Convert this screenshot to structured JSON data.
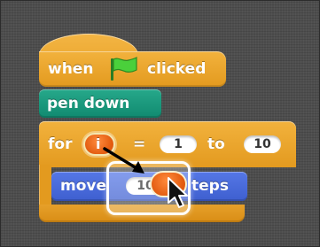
{
  "script": {
    "hat": {
      "when_label": "when",
      "clicked_label": "clicked",
      "flag_icon": "green-flag-icon"
    },
    "pen_down": {
      "label": "pen down"
    },
    "for_loop": {
      "for_label": "for",
      "variable": "i",
      "equals_label": "=",
      "start_value": "1",
      "to_label": "to",
      "end_value": "10"
    },
    "move": {
      "label_left": "move",
      "value_visible": "10",
      "label_right": "teps"
    }
  },
  "drag": {
    "cursor_icon": "arrow-cursor-icon",
    "dragged_variable": "i"
  },
  "colors": {
    "control_block": "#e9a42a",
    "pen_block": "#1a9b7e",
    "motion_block": "#4a6cd4",
    "variable": "#f26b1d",
    "background": "#4e4e4e"
  }
}
